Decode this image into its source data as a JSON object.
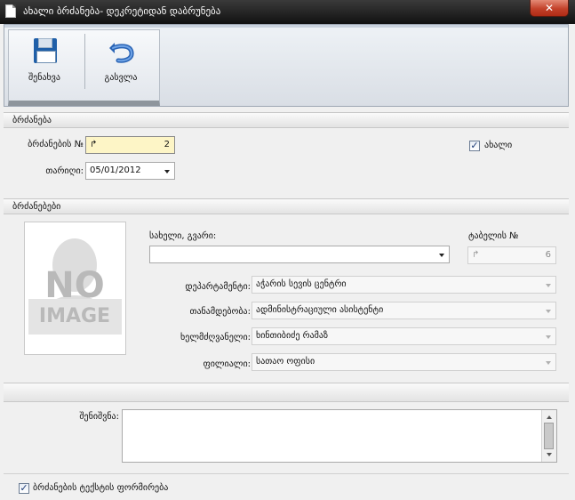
{
  "window": {
    "title": "ახალი ბრძანება- დეკრეტიდან დაბრუნება",
    "close_glyph": "✕"
  },
  "ribbon": {
    "save_label": "შენახვა",
    "exit_label": "გასვლა"
  },
  "order_section": {
    "header": "ბრძანება",
    "number_label": "ბრძანების №",
    "number_value": "2",
    "number_icon": "↱",
    "date_label": "თარიღი:",
    "date_value": "05/01/2012",
    "new_label": "ახალი",
    "new_checked": true
  },
  "orders_section": {
    "header": "ბრძანებები",
    "name_label": "სახელი, გვარი:",
    "name_value": "",
    "tabel_label": "ტაბელის №",
    "tabel_value": "6",
    "tabel_icon": "↱",
    "department_label": "დეპარტამენტი:",
    "department_value": "აჭარის სევის ცენტრი",
    "position_label": "თანამდებობა:",
    "position_value": "ადმინისტრაციული ასისტენტი",
    "manager_label": "ხელმძღვანელი:",
    "manager_value": "ხინთიბიძე რამაზ",
    "branch_label": "ფილიალი:",
    "branch_value": "სათაო ოფისი",
    "photo_text_1": "NO",
    "photo_text_2": "IMAGE"
  },
  "notes": {
    "label": "შენიშვნა:",
    "value": ""
  },
  "footer": {
    "generate_label": "ბრძანების ტექსტის ფორმირება",
    "generate_checked": true
  }
}
